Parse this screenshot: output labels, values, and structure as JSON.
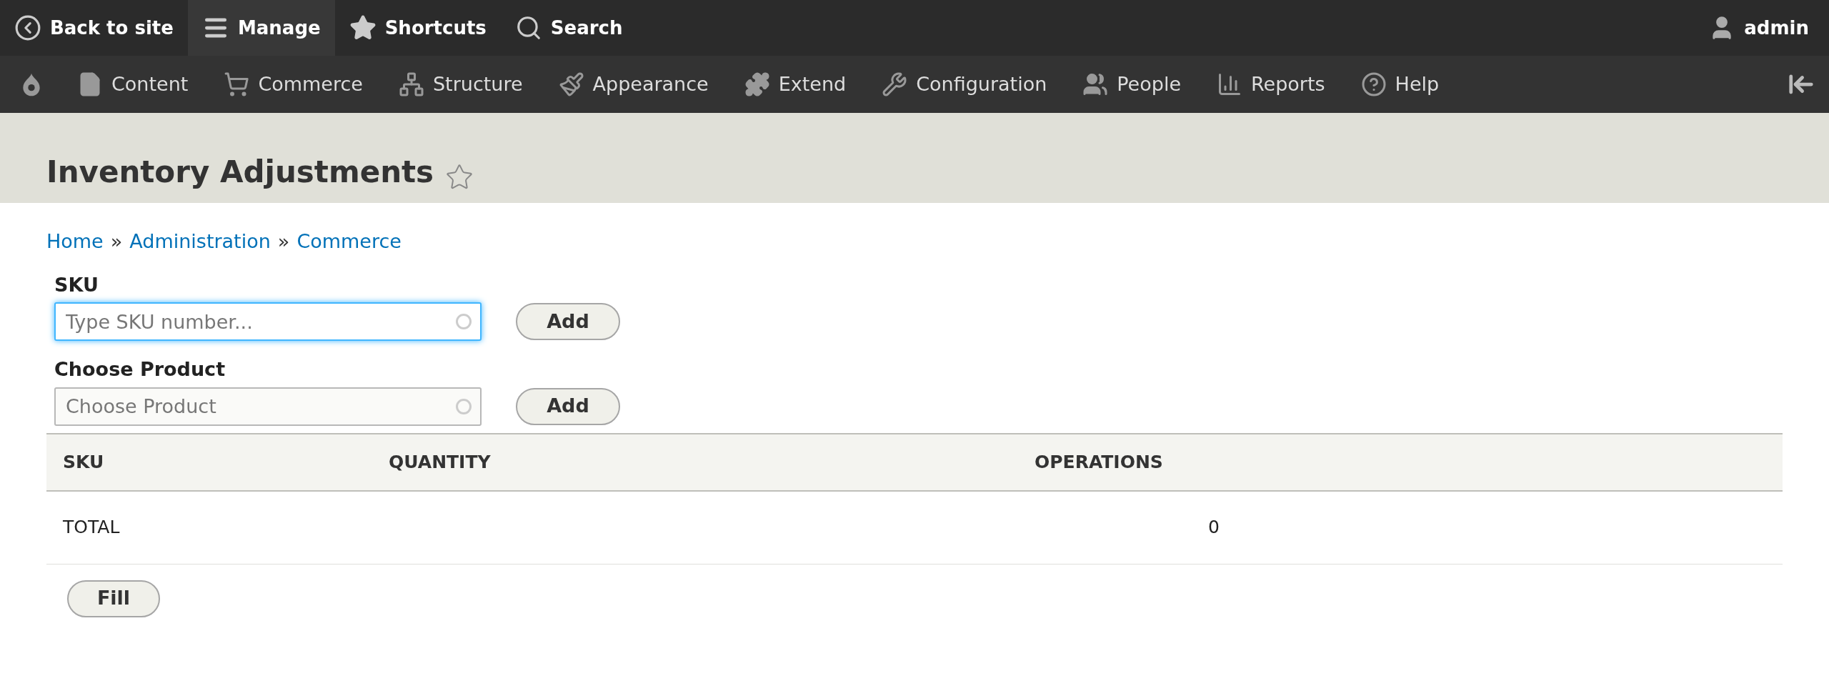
{
  "toolbar": {
    "tabs": [
      {
        "label": "Back to site",
        "selected": false
      },
      {
        "label": "Manage",
        "selected": true
      },
      {
        "label": "Shortcuts",
        "selected": false
      },
      {
        "label": "Search",
        "selected": false
      }
    ],
    "user": "admin"
  },
  "admin_menu": [
    "Content",
    "Commerce",
    "Structure",
    "Appearance",
    "Extend",
    "Configuration",
    "People",
    "Reports",
    "Help"
  ],
  "page": {
    "title": "Inventory Adjustments",
    "breadcrumb": [
      "Home",
      "Administration",
      "Commerce"
    ],
    "breadcrumb_separator": "»"
  },
  "form": {
    "fields": [
      {
        "label": "SKU",
        "placeholder": "Type SKU number...",
        "focused": true,
        "button": "Add"
      },
      {
        "label": "Choose Product",
        "placeholder": "Choose Product",
        "focused": false,
        "button": "Add"
      }
    ]
  },
  "table": {
    "columns": [
      "SKU",
      "QUANTITY",
      "OPERATIONS"
    ],
    "total_row": {
      "label": "TOTAL",
      "value": "0"
    }
  },
  "fill_button": "Fill"
}
